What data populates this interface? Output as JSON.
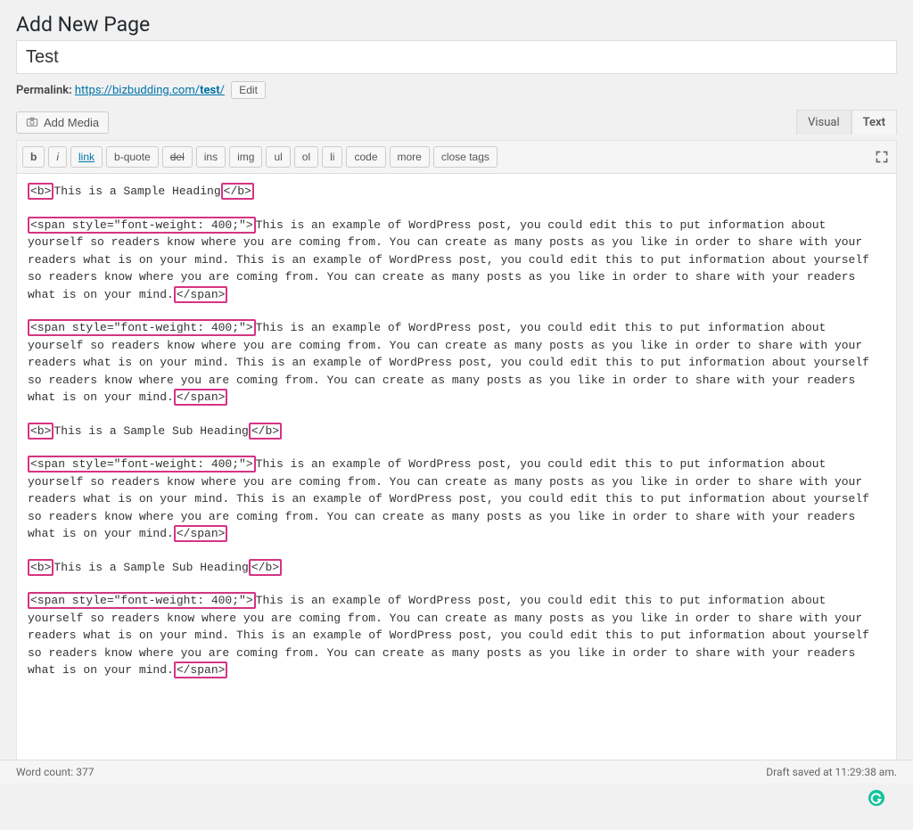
{
  "page": {
    "title": "Add New Page",
    "title_input_value": "Test"
  },
  "permalink": {
    "label": "Permalink:",
    "url_prefix": "https://bizbudding.com/",
    "url_slug": "test",
    "url_suffix": "/",
    "edit_label": "Edit"
  },
  "media_button": {
    "label": "Add Media"
  },
  "tabs": {
    "visual": "Visual",
    "text": "Text"
  },
  "quicktags": [
    {
      "label": "b",
      "style": "bold"
    },
    {
      "label": "i",
      "style": "italic"
    },
    {
      "label": "link",
      "style": "link"
    },
    {
      "label": "b-quote",
      "style": ""
    },
    {
      "label": "del",
      "style": "strike"
    },
    {
      "label": "ins",
      "style": ""
    },
    {
      "label": "img",
      "style": ""
    },
    {
      "label": "ul",
      "style": ""
    },
    {
      "label": "ol",
      "style": ""
    },
    {
      "label": "li",
      "style": ""
    },
    {
      "label": "code",
      "style": ""
    },
    {
      "label": "more",
      "style": ""
    },
    {
      "label": "close tags",
      "style": ""
    }
  ],
  "content": {
    "tag_b_open": "<b>",
    "tag_b_close": "</b>",
    "tag_span_open": "<span style=\"font-weight: 400;\">",
    "tag_span_close": "</span>",
    "heading1": "This is a Sample Heading",
    "heading2": "This is a Sample Sub Heading",
    "heading3": "This is a Sample Sub Heading",
    "paragraph": "This is an example of WordPress post, you could edit this to put information about yourself so readers know where you are coming from. You can create as many posts as you like in order to share with your readers what is on your mind. This is an example of WordPress post, you could edit this to put information about yourself so readers know where you are coming from. You can create as many posts as you like in order to share with your readers what is on your mind."
  },
  "status": {
    "word_count_label": "Word count:",
    "word_count_value": "377",
    "draft_saved_label": "Draft saved at",
    "draft_saved_time": "11:29:38 am."
  }
}
